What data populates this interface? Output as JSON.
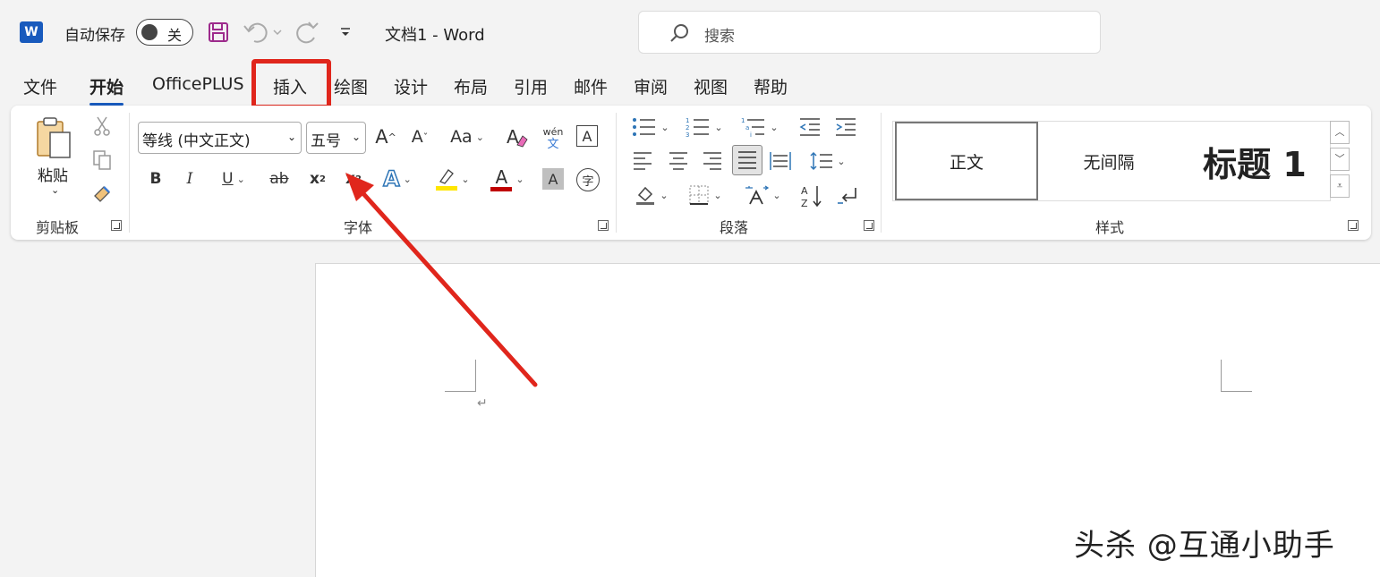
{
  "titlebar": {
    "app_logo": "W",
    "autosave_label": "自动保存",
    "autosave_state": "关",
    "doc_title": "文档1  -  Word",
    "search_placeholder": "搜索",
    "icons": [
      "word-logo",
      "save-icon",
      "undo-icon",
      "redo-icon",
      "customize-qat-icon",
      "search-icon"
    ]
  },
  "tabs": [
    {
      "label": "文件"
    },
    {
      "label": "开始",
      "active": true
    },
    {
      "label": "OfficePLUS"
    },
    {
      "label": "插入",
      "highlighted": true
    },
    {
      "label": "绘图"
    },
    {
      "label": "设计"
    },
    {
      "label": "布局"
    },
    {
      "label": "引用"
    },
    {
      "label": "邮件"
    },
    {
      "label": "审阅"
    },
    {
      "label": "视图"
    },
    {
      "label": "帮助"
    }
  ],
  "clipboard": {
    "paste_label": "粘贴",
    "group_label": "剪贴板"
  },
  "font": {
    "font_name": "等线 (中文正文)",
    "font_size": "五号",
    "group_label": "字体",
    "grow_font": "A",
    "shrink_font": "A",
    "change_case": "Aa",
    "phonetic_top": "wén",
    "phonetic_bottom": "文",
    "char_border": "A",
    "bold": "B",
    "italic": "I",
    "underline": "U",
    "strikethrough": "ab",
    "subscript": "x",
    "subscript_sub": "2",
    "superscript": "x",
    "superscript_sup": "2",
    "text_effects": "A",
    "font_color": "A",
    "char_shading": "A",
    "enclose_char": "字",
    "highlight_color": "#ffe600",
    "font_color_value": "#c00000"
  },
  "paragraph": {
    "group_label": "段落"
  },
  "styles": {
    "group_label": "样式",
    "items": [
      "正文",
      "无间隔",
      "标题 1"
    ]
  },
  "document": {
    "paragraph_mark": "↵"
  },
  "watermark": "头杀 @互通小助手",
  "colors": {
    "accent": "#185abd",
    "annotation": "#e0261c"
  }
}
